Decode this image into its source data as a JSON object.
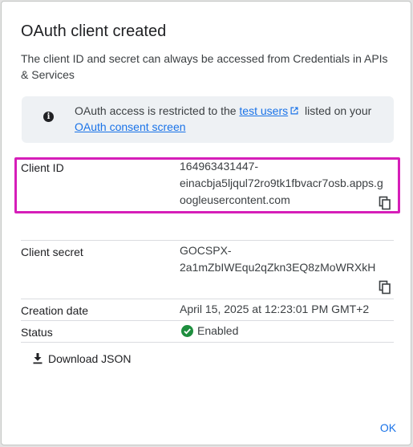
{
  "dialog": {
    "title": "OAuth client created",
    "intro": "The client ID and secret can always be accessed from Credentials in APIs & Services"
  },
  "info": {
    "icon": "info-icon",
    "text_before": "OAuth access is restricted to the ",
    "test_users_link": "test users",
    "text_middle": " listed on your ",
    "consent_link": "OAuth consent screen"
  },
  "details": {
    "client_id_label": "Client ID",
    "client_id_lines": [
      "164963431447-",
      "einacbja5ljqul72ro9tk1fbvacr7osb.apps.g",
      "oogleusercontent.com"
    ],
    "client_secret_label": "Client secret",
    "client_secret_lines": [
      "GOCSPX-",
      "2a1mZbIWEqu2qZkn3EQ8zMoWRXkH"
    ],
    "creation_date_label": "Creation date",
    "creation_date_value": "April 15, 2025 at 12:23:01 PM GMT+2",
    "status_label": "Status",
    "status_value": "Enabled"
  },
  "actions": {
    "download_label": "Download JSON",
    "ok_label": "OK"
  },
  "colors": {
    "link": "#1a73e8",
    "highlight": "#d61eb9",
    "status_ok": "#1e8e3e"
  }
}
